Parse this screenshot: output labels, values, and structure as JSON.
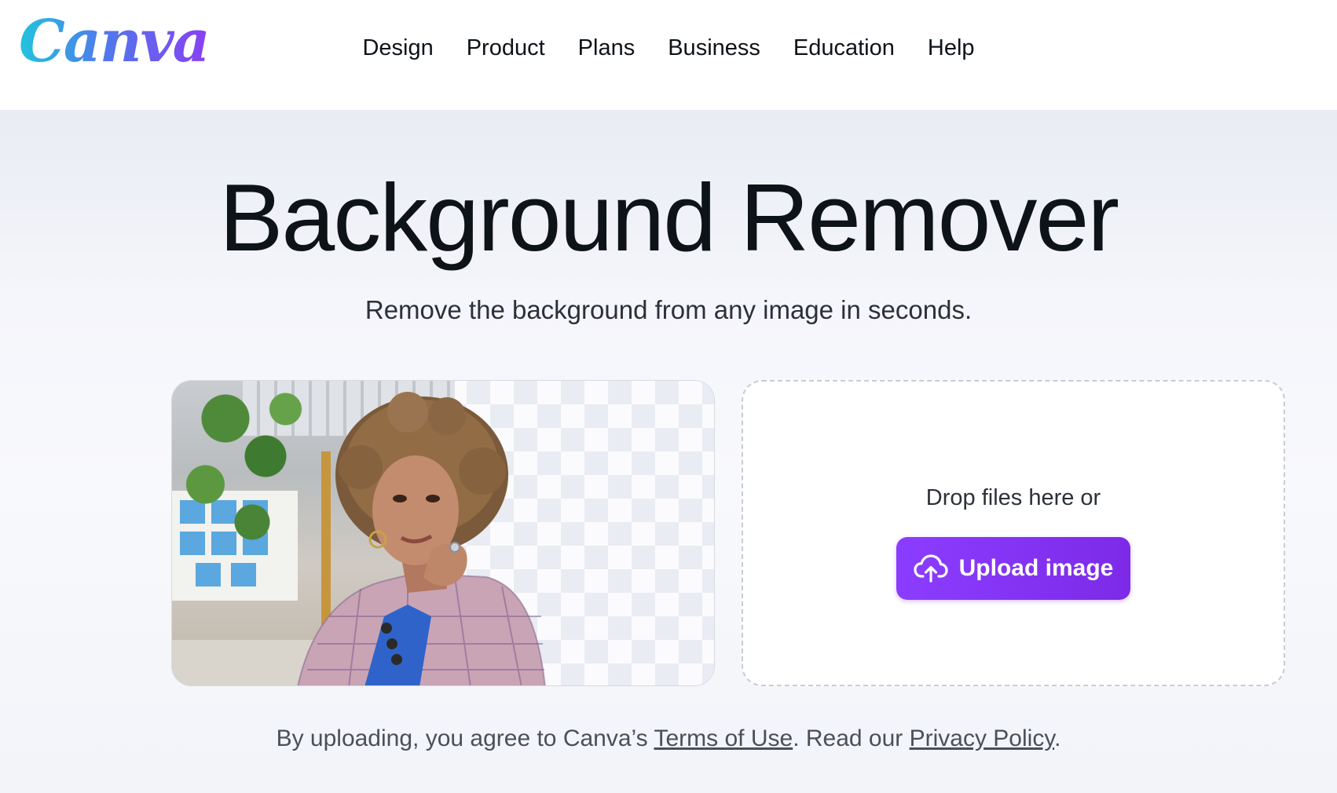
{
  "header": {
    "logo": "Canva",
    "nav": [
      "Design",
      "Product",
      "Plans",
      "Business",
      "Education",
      "Help"
    ]
  },
  "hero": {
    "title": "Background Remover",
    "subtitle": "Remove the background from any image in seconds."
  },
  "upload": {
    "drop_text": "Drop files here or",
    "button_label": "Upload image",
    "button_icon": "cloud-upload-icon"
  },
  "terms": {
    "prefix": "By uploading, you agree to Canva’s ",
    "terms_link": "Terms of Use",
    "middle": ". Read our ",
    "privacy_link": "Privacy Policy",
    "suffix": "."
  },
  "colors": {
    "accent": "#7d2ae8",
    "text": "#0e1318"
  }
}
